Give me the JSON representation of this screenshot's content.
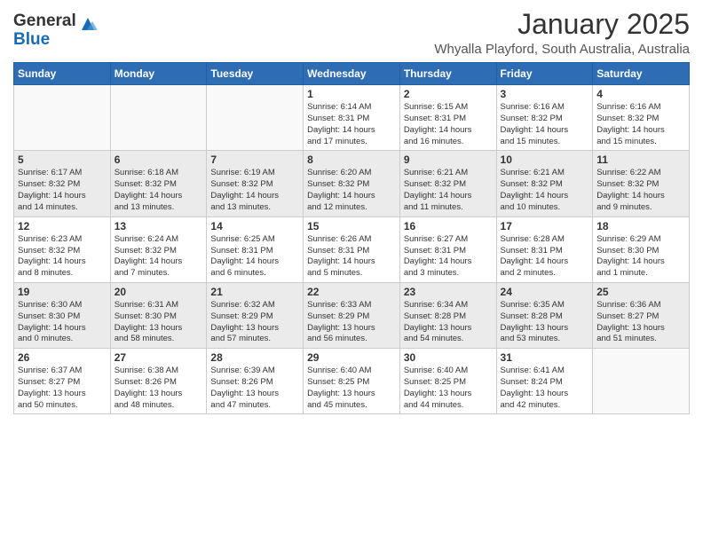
{
  "logo": {
    "general": "General",
    "blue": "Blue"
  },
  "header": {
    "title": "January 2025",
    "subtitle": "Whyalla Playford, South Australia, Australia"
  },
  "weekdays": [
    "Sunday",
    "Monday",
    "Tuesday",
    "Wednesday",
    "Thursday",
    "Friday",
    "Saturday"
  ],
  "weeks": [
    [
      {
        "day": "",
        "info": ""
      },
      {
        "day": "",
        "info": ""
      },
      {
        "day": "",
        "info": ""
      },
      {
        "day": "1",
        "info": "Sunrise: 6:14 AM\nSunset: 8:31 PM\nDaylight: 14 hours\nand 17 minutes."
      },
      {
        "day": "2",
        "info": "Sunrise: 6:15 AM\nSunset: 8:31 PM\nDaylight: 14 hours\nand 16 minutes."
      },
      {
        "day": "3",
        "info": "Sunrise: 6:16 AM\nSunset: 8:32 PM\nDaylight: 14 hours\nand 15 minutes."
      },
      {
        "day": "4",
        "info": "Sunrise: 6:16 AM\nSunset: 8:32 PM\nDaylight: 14 hours\nand 15 minutes."
      }
    ],
    [
      {
        "day": "5",
        "info": "Sunrise: 6:17 AM\nSunset: 8:32 PM\nDaylight: 14 hours\nand 14 minutes."
      },
      {
        "day": "6",
        "info": "Sunrise: 6:18 AM\nSunset: 8:32 PM\nDaylight: 14 hours\nand 13 minutes."
      },
      {
        "day": "7",
        "info": "Sunrise: 6:19 AM\nSunset: 8:32 PM\nDaylight: 14 hours\nand 13 minutes."
      },
      {
        "day": "8",
        "info": "Sunrise: 6:20 AM\nSunset: 8:32 PM\nDaylight: 14 hours\nand 12 minutes."
      },
      {
        "day": "9",
        "info": "Sunrise: 6:21 AM\nSunset: 8:32 PM\nDaylight: 14 hours\nand 11 minutes."
      },
      {
        "day": "10",
        "info": "Sunrise: 6:21 AM\nSunset: 8:32 PM\nDaylight: 14 hours\nand 10 minutes."
      },
      {
        "day": "11",
        "info": "Sunrise: 6:22 AM\nSunset: 8:32 PM\nDaylight: 14 hours\nand 9 minutes."
      }
    ],
    [
      {
        "day": "12",
        "info": "Sunrise: 6:23 AM\nSunset: 8:32 PM\nDaylight: 14 hours\nand 8 minutes."
      },
      {
        "day": "13",
        "info": "Sunrise: 6:24 AM\nSunset: 8:32 PM\nDaylight: 14 hours\nand 7 minutes."
      },
      {
        "day": "14",
        "info": "Sunrise: 6:25 AM\nSunset: 8:31 PM\nDaylight: 14 hours\nand 6 minutes."
      },
      {
        "day": "15",
        "info": "Sunrise: 6:26 AM\nSunset: 8:31 PM\nDaylight: 14 hours\nand 5 minutes."
      },
      {
        "day": "16",
        "info": "Sunrise: 6:27 AM\nSunset: 8:31 PM\nDaylight: 14 hours\nand 3 minutes."
      },
      {
        "day": "17",
        "info": "Sunrise: 6:28 AM\nSunset: 8:31 PM\nDaylight: 14 hours\nand 2 minutes."
      },
      {
        "day": "18",
        "info": "Sunrise: 6:29 AM\nSunset: 8:30 PM\nDaylight: 14 hours\nand 1 minute."
      }
    ],
    [
      {
        "day": "19",
        "info": "Sunrise: 6:30 AM\nSunset: 8:30 PM\nDaylight: 14 hours\nand 0 minutes."
      },
      {
        "day": "20",
        "info": "Sunrise: 6:31 AM\nSunset: 8:30 PM\nDaylight: 13 hours\nand 58 minutes."
      },
      {
        "day": "21",
        "info": "Sunrise: 6:32 AM\nSunset: 8:29 PM\nDaylight: 13 hours\nand 57 minutes."
      },
      {
        "day": "22",
        "info": "Sunrise: 6:33 AM\nSunset: 8:29 PM\nDaylight: 13 hours\nand 56 minutes."
      },
      {
        "day": "23",
        "info": "Sunrise: 6:34 AM\nSunset: 8:28 PM\nDaylight: 13 hours\nand 54 minutes."
      },
      {
        "day": "24",
        "info": "Sunrise: 6:35 AM\nSunset: 8:28 PM\nDaylight: 13 hours\nand 53 minutes."
      },
      {
        "day": "25",
        "info": "Sunrise: 6:36 AM\nSunset: 8:27 PM\nDaylight: 13 hours\nand 51 minutes."
      }
    ],
    [
      {
        "day": "26",
        "info": "Sunrise: 6:37 AM\nSunset: 8:27 PM\nDaylight: 13 hours\nand 50 minutes."
      },
      {
        "day": "27",
        "info": "Sunrise: 6:38 AM\nSunset: 8:26 PM\nDaylight: 13 hours\nand 48 minutes."
      },
      {
        "day": "28",
        "info": "Sunrise: 6:39 AM\nSunset: 8:26 PM\nDaylight: 13 hours\nand 47 minutes."
      },
      {
        "day": "29",
        "info": "Sunrise: 6:40 AM\nSunset: 8:25 PM\nDaylight: 13 hours\nand 45 minutes."
      },
      {
        "day": "30",
        "info": "Sunrise: 6:40 AM\nSunset: 8:25 PM\nDaylight: 13 hours\nand 44 minutes."
      },
      {
        "day": "31",
        "info": "Sunrise: 6:41 AM\nSunset: 8:24 PM\nDaylight: 13 hours\nand 42 minutes."
      },
      {
        "day": "",
        "info": ""
      }
    ]
  ]
}
